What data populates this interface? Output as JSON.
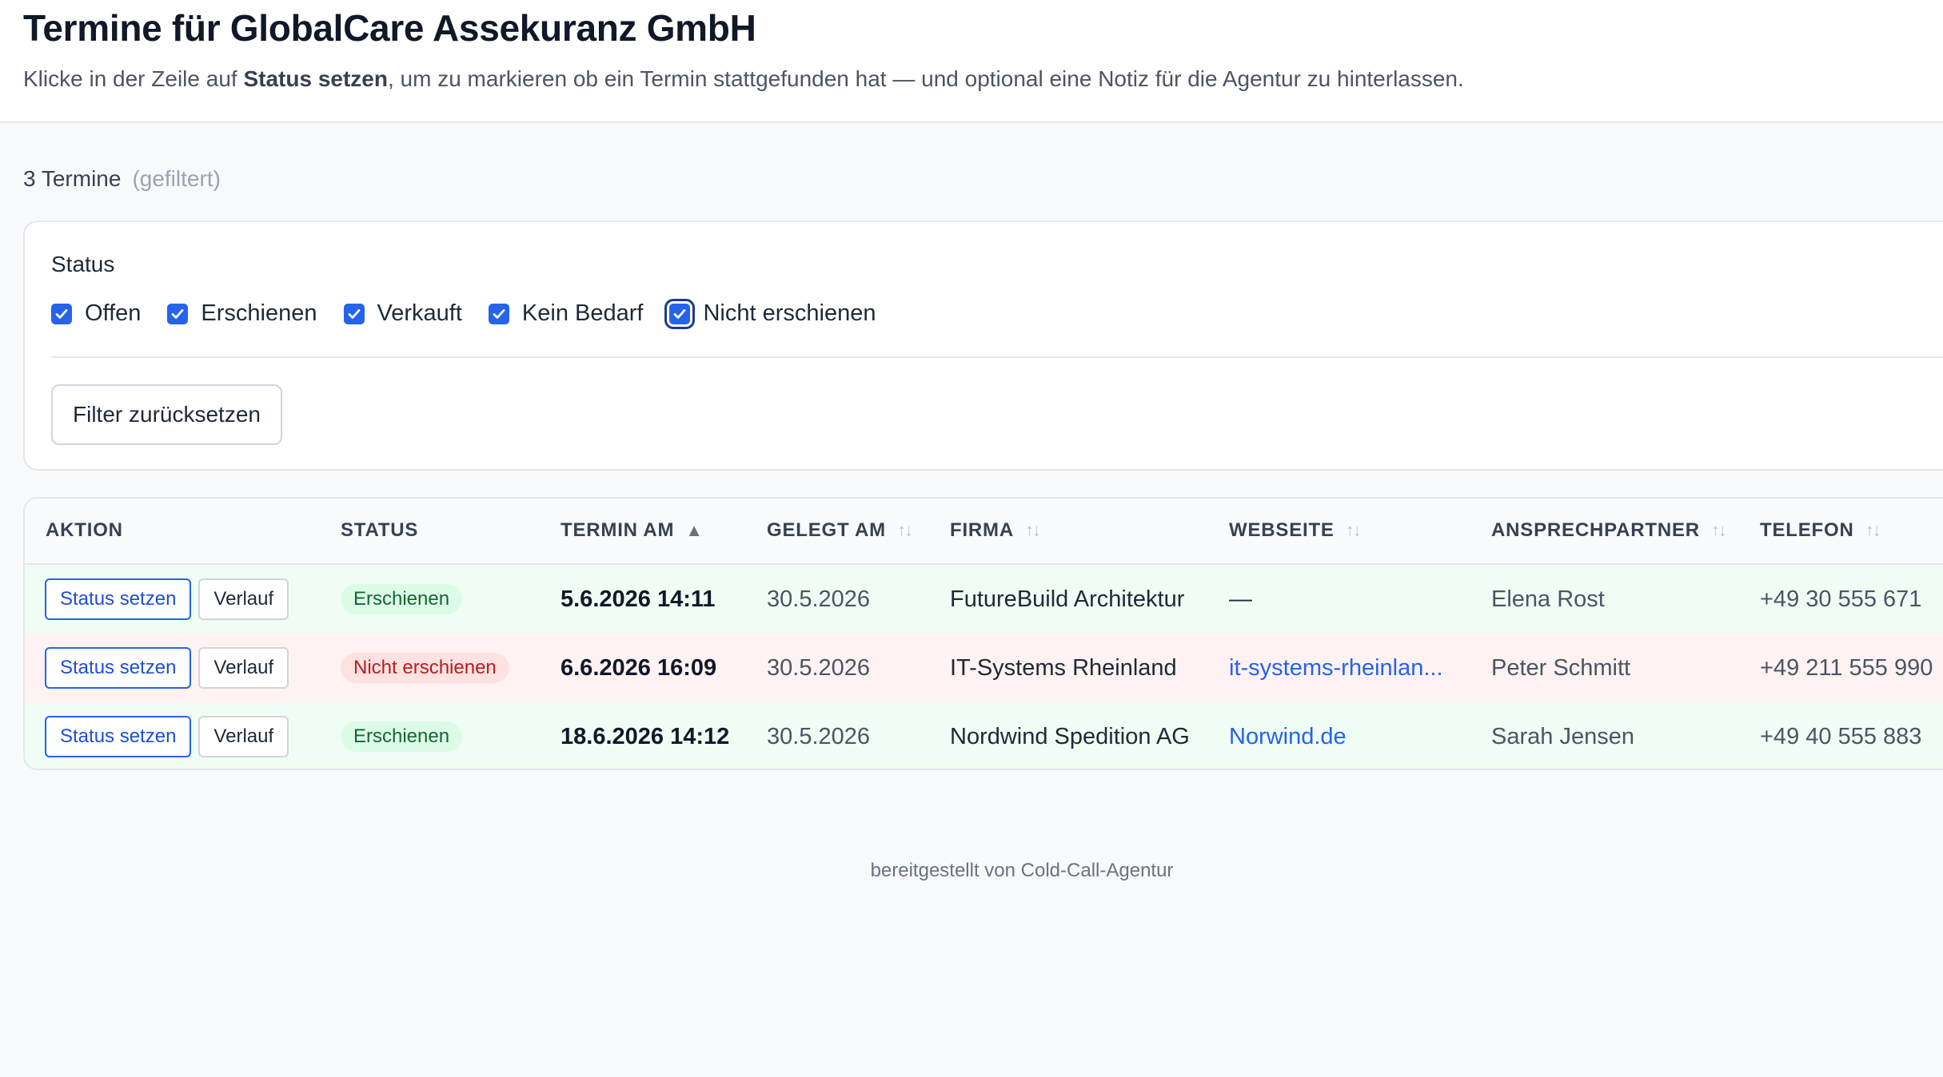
{
  "header": {
    "title": "Termine für GlobalCare Assekuranz GmbH",
    "hint_before": "Klicke in der Zeile auf ",
    "hint_bold": "Status setzen",
    "hint_after": ", um zu markieren ob ein Termin stattgefunden hat — und optional eine Notiz für die Agentur zu hinterlassen."
  },
  "summary": {
    "count": "3 Termine",
    "filtered": "(gefiltert)"
  },
  "filter": {
    "label": "Status",
    "options": [
      {
        "label": "Offen",
        "checked": true
      },
      {
        "label": "Erschienen",
        "checked": true
      },
      {
        "label": "Verkauft",
        "checked": true
      },
      {
        "label": "Kein Bedarf",
        "checked": true
      },
      {
        "label": "Nicht erschienen",
        "checked": true
      }
    ],
    "reset_label": "Filter zurücksetzen"
  },
  "table": {
    "columns": [
      "AKTION",
      "STATUS",
      "TERMIN AM",
      "GELEGT AM",
      "FIRMA",
      "WEBSEITE",
      "ANSPRECHPARTNER",
      "TELEFON"
    ],
    "sort_active_icon": "▲",
    "sort_icon": "↑↓",
    "action_status_label": "Status setzen",
    "action_history_label": "Verlauf",
    "rows": [
      {
        "status": "Erschienen",
        "termin": "5.6.2026 14:11",
        "gelegt": "30.5.2026",
        "firma": "FutureBuild Architektur",
        "webseite": "—",
        "ansprechpartner": "Elena Rost",
        "telefon": "+49 30 555 671"
      },
      {
        "status": "Nicht erschienen",
        "termin": "6.6.2026 16:09",
        "gelegt": "30.5.2026",
        "firma": "IT-Systems Rheinland",
        "webseite": "it-systems-rheinlan...",
        "ansprechpartner": "Peter Schmitt",
        "telefon": "+49 211 555 990"
      },
      {
        "status": "Erschienen",
        "termin": "18.6.2026 14:12",
        "gelegt": "30.5.2026",
        "firma": "Nordwind Spedition AG",
        "webseite": "Norwind.de",
        "ansprechpartner": "Sarah Jensen",
        "telefon": "+49 40 555 883"
      }
    ]
  },
  "footer": {
    "text": "bereitgestellt von Cold-Call-Agentur"
  },
  "colors": {
    "accent": "#2563eb",
    "success_bg": "#f0fdf4",
    "danger_bg": "#fef2f2",
    "success_badge": "#dcfce7",
    "danger_badge": "#fee2e2"
  }
}
